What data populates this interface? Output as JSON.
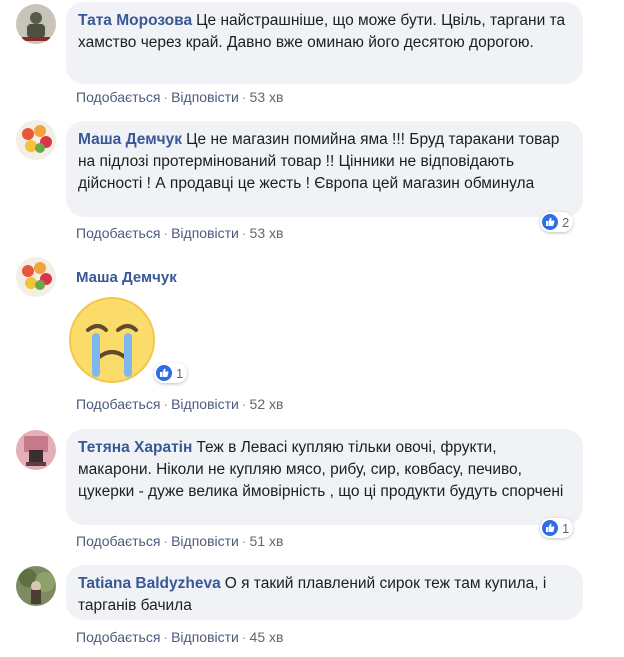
{
  "actions": {
    "like": "Подобається",
    "reply": "Відповісти",
    "separator": "·"
  },
  "colors": {
    "author": "#385898",
    "bubble": "#f0f2f5",
    "like_badge": "#2f6ce5"
  },
  "comments": [
    {
      "author": "Тата Морозова",
      "text": "Це найстрашніше, що може бути. Цвіль, таргани та хамство через край. Давно вже оминаю його десятою дорогою.",
      "time": "53 хв",
      "avatar_icon": "soldier-avatar-icon"
    },
    {
      "author": "Маша Демчук",
      "text": "Це не магазин помийна яма !!! Бруд таракани товар на підлозі протермінований товар !! Цінники не відповідають дійсності ! А продавці це жесть ! Європа цей магазин обминула",
      "time": "53 хв",
      "reactions": "2",
      "avatar_icon": "flowers-avatar-icon"
    },
    {
      "author": "Маша Демчук",
      "sticker": "crying-face-emoji-icon",
      "time": "52 хв",
      "reactions": "1",
      "avatar_icon": "flowers-avatar-icon"
    },
    {
      "author": "Тетяна Харатін",
      "text": "Теж в Левасі купляю тільки овочі, фрукти, макарони. Ніколи не купляю мясо, рибу, сир, ковбасу, печиво, цукерки - дуже велика ймовірність , що ці продукти будуть спорчені",
      "time": "51 хв",
      "reactions": "1",
      "avatar_icon": "pink-room-avatar-icon"
    },
    {
      "author": "Tatiana Baldyzheva",
      "text": "О я такий плавлений сирок теж там купила, і тарганів бачила",
      "time": "45 хв",
      "avatar_icon": "garden-avatar-icon"
    }
  ]
}
